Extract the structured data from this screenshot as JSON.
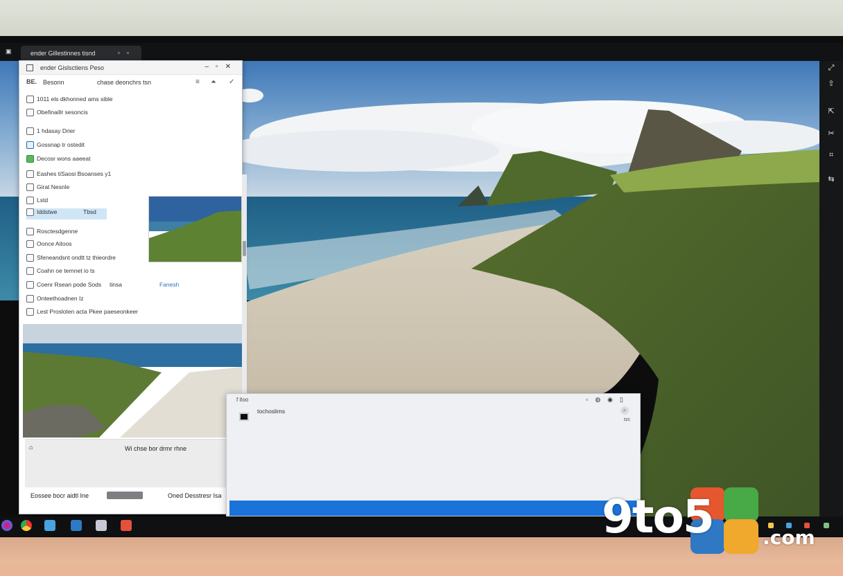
{
  "tab": {
    "title": "ender Gillestinnes tisnd"
  },
  "explorer": {
    "title": "ender Gislsctiens Peso",
    "toolbar": {
      "label_a": "BE.",
      "label_b": "Besonn",
      "label_c": "chase deonchrs tsn"
    },
    "rows": [
      {
        "text": "1011 els dkhonned ams sible"
      },
      {
        "text": "Obefinaillr sesoncis"
      },
      {
        "text": "1 hdasay Drier"
      },
      {
        "text": "Gossnap tr ostedit"
      },
      {
        "text": "Decosr wons aaeeat",
        "icon": "green"
      },
      {
        "text": "Eashes tiSaosi Bsoanses y1"
      },
      {
        "text": "Girat Nesnle"
      },
      {
        "text": "Lstd"
      },
      {
        "text": "Iddstwe",
        "side": "Tbsd",
        "selected": true
      },
      {
        "text": "Rosctesdgenne"
      },
      {
        "text": "Oonce Aitoos"
      },
      {
        "text": "Sfeneandsnt ondtt tz thieordre"
      },
      {
        "text": "Coahn oe ternnet io ts"
      },
      {
        "text": "Coenr Rsean pode Sods",
        "side": "tinsa",
        "side2": "Fanesh"
      },
      {
        "text": "Onteethoadnen Iz"
      },
      {
        "text": "Lest Prosloten acta Pkee paeseonkeer"
      }
    ],
    "footer": {
      "left": "",
      "right": "Wi chse bor drmr rhne"
    },
    "status": {
      "left": "Eossee bocr aidtl Ine",
      "right": "Oned Desstresr Isa"
    }
  },
  "dialog": {
    "title": "f Iloo",
    "label": "tochoslims",
    "side": "tzc"
  },
  "watermark": {
    "brand": "9to5",
    "suffix": ".com"
  },
  "colors": {
    "accent": "#1a73d8",
    "selection": "#cfe6f6",
    "taskbar": "#0f1012"
  },
  "icons": {
    "taskbar": [
      "copilot-icon",
      "chrome-icon",
      "explorer-icon",
      "mail-icon",
      "terminal-icon",
      "store-icon"
    ],
    "rail": [
      "expand-icon",
      "pin-icon",
      "share-icon",
      "cut-icon",
      "crop-icon",
      "arrow-icon"
    ]
  }
}
